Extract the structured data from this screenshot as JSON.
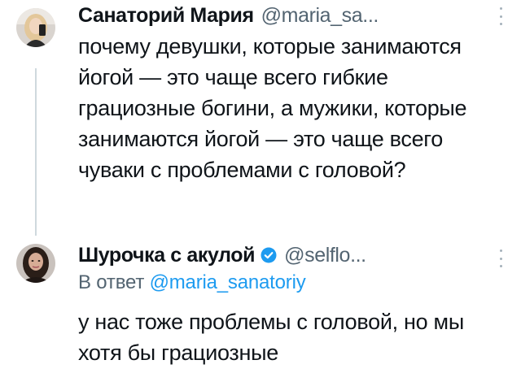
{
  "tweet1": {
    "name": "Санаторий Мария",
    "handle": "@maria_sa...",
    "avatar": "blonde-woman-avatar",
    "text": "почему девушки, которые занимаются йогой — это чаще всего гибкие грациозные богини, а мужики, которые занимаются йогой — это чаще всего чуваки с проблемами с головой?"
  },
  "tweet2": {
    "name": "Шурочка с акулой",
    "handle": "@selflo...",
    "verified": true,
    "avatar": "dark-haired-woman-avatar",
    "reply_prefix": "В ответ",
    "reply_mention": "@maria_sanatoriy",
    "text": "у нас тоже проблемы с головой, но мы хотя бы грациозные"
  },
  "colors": {
    "text": "#0f1419",
    "secondary": "#536471",
    "link": "#1d9bf0",
    "verified": "#1d9bf0",
    "thread_line": "#cfd9de"
  },
  "icons": {
    "more": "more-vertical-icon",
    "verified": "verified-badge-icon"
  }
}
